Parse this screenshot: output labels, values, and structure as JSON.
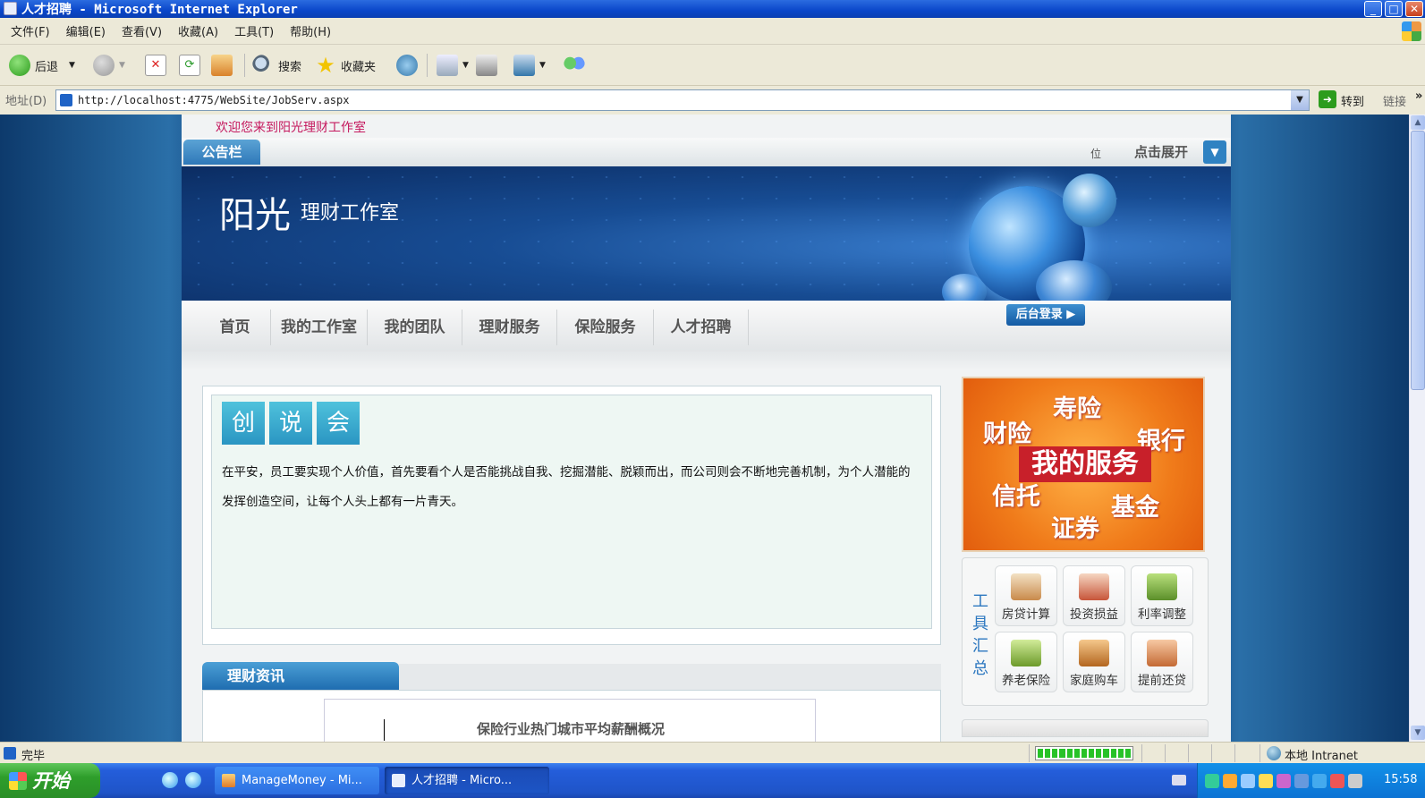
{
  "window": {
    "title": "人才招聘 - Microsoft Internet Explorer"
  },
  "menu": [
    "文件(F)",
    "编辑(E)",
    "查看(V)",
    "收藏(A)",
    "工具(T)",
    "帮助(H)"
  ],
  "toolbar": {
    "back": "后退",
    "search": "搜索",
    "favorites": "收藏夹"
  },
  "address": {
    "label": "地址(D)",
    "url": "http://localhost:4775/WebSite/JobServ.aspx",
    "go": "转到",
    "links": "链接"
  },
  "page": {
    "welcome": "欢迎您来到阳光理财工作室",
    "notice_tab": "公告栏",
    "notice_mark": "位",
    "expand": "点击展开",
    "banner_main": "阳光",
    "banner_sub": "理财工作室",
    "nav": [
      "首页",
      "我的工作室",
      "我的团队",
      "理财服务",
      "保险服务",
      "人才招聘"
    ],
    "login": "后台登录",
    "title_chars": [
      "创",
      "说",
      "会"
    ],
    "paragraph": "在平安，员工要实现个人价值，首先要看个人是否能挑战自我、挖掘潜能、脱颖而出，而公司则会不断地完善机制，为个人潜能的发挥创造空间，让每个人头上都有一片青天。",
    "news_tab": "理财资讯",
    "news_title": "保险行业热门城市平均薪酬概况",
    "ad": {
      "words": [
        "寿险",
        "财险",
        "银行",
        "信托",
        "基金",
        "证券"
      ],
      "main": "我的服务"
    },
    "tools_title": "工具汇总",
    "tools": [
      "房贷计算",
      "投资损益",
      "利率调整",
      "养老保险",
      "家庭购车",
      "提前还贷"
    ]
  },
  "status": {
    "text": "完毕",
    "zone": "本地 Intranet",
    "progress": 1.0
  },
  "taskbar": {
    "start": "开始",
    "tasks": [
      "ManageMoney - Mi...",
      "人才招聘 - Micro..."
    ],
    "clock": "15:58"
  },
  "colors": {
    "accent": "#2e78b8",
    "welcome": "#c5195e",
    "ad": "#f07b1a"
  }
}
